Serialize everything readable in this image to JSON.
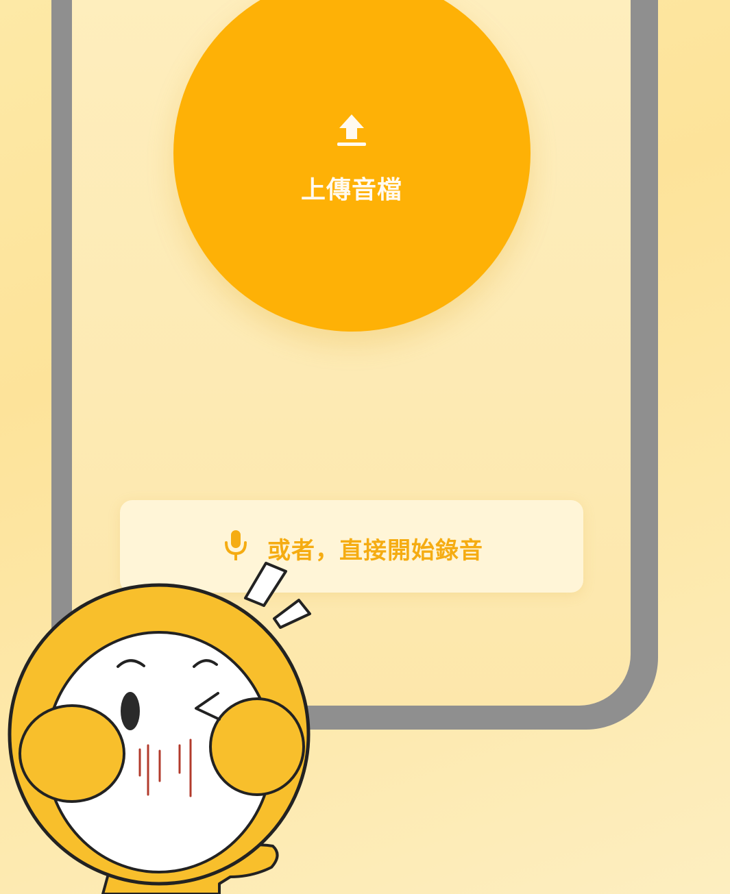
{
  "upload": {
    "label": "上傳音檔",
    "icon": "upload-icon"
  },
  "record": {
    "label": "或者，直接開始錄音",
    "icon": "microphone-icon"
  },
  "colors": {
    "accent": "#feb106",
    "record_text": "#f5ac12",
    "frame": "#8f8f8f",
    "background": "#fde9a6"
  },
  "mascot": {
    "name": "mascot-character"
  }
}
